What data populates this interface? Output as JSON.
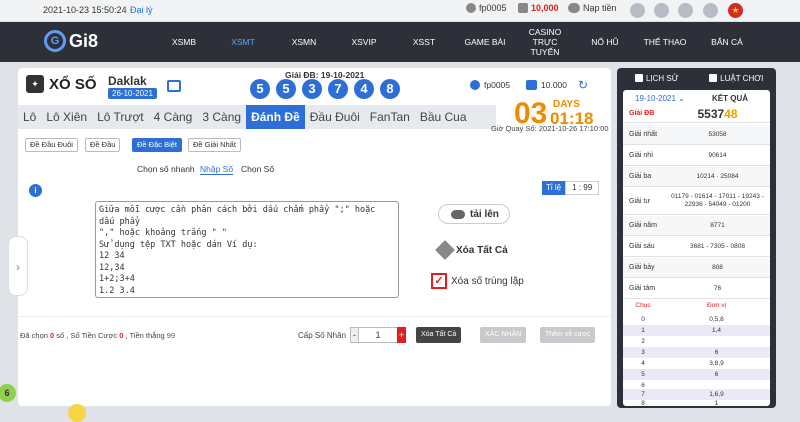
{
  "topbar": {
    "datetime": "2021-10-23 15:50:24",
    "agent": "Đại lý",
    "username": "fp0005",
    "balance": "10,000",
    "deposit": "Nạp tiền",
    "flag": "★"
  },
  "nav": {
    "logo": "Gi8",
    "items": [
      {
        "label": "XSMB"
      },
      {
        "label": "XSMT"
      },
      {
        "label": "XSMN"
      },
      {
        "label": "XSVIP"
      },
      {
        "label": "XSST"
      },
      {
        "label": "GAME BÀI"
      },
      {
        "label": "CASINO TRỰC TUYẾN"
      },
      {
        "label": "NỔ HŨ"
      },
      {
        "label": "THỂ THAO"
      },
      {
        "label": "BẮN CÁ"
      }
    ]
  },
  "game": {
    "title": "XỔ SỐ",
    "province": "Daklak",
    "province_date": "26-10-2021",
    "gdb_label": "Giải ĐB: 19-10-2021",
    "balls": [
      "5",
      "5",
      "3",
      "7",
      "4",
      "8"
    ],
    "account": "fp0005",
    "account_balance": "10.000",
    "tabs": [
      {
        "label": "Lô"
      },
      {
        "label": "Lô Xiên"
      },
      {
        "label": "Lô Trượt"
      },
      {
        "label": "4 Càng"
      },
      {
        "label": "3 Càng"
      },
      {
        "label": "Đánh Đề"
      },
      {
        "label": "Đầu Đuôi"
      },
      {
        "label": "FanTan"
      },
      {
        "label": "Bầu Cua"
      }
    ],
    "countdown": {
      "days_num": "03",
      "days_label": "DAYS",
      "time": "01:18",
      "next_draw": "Giờ Quay Số: 2021-10-26 17:10:00"
    },
    "subtabs": [
      "Đề Đầu Đuôi",
      "Đề Đầu",
      "Đề Đặc Biệt",
      "Đề Giải Nhất"
    ],
    "modes": [
      "Chọn số nhanh",
      "Nhập Số",
      "Chọn Số"
    ],
    "ratio_label": "Tỉ lệ",
    "ratio_value": "1 : 99",
    "textarea": "Giữa mỗi cược cần phân cách bởi dấu chấm phẩy \";\" hoặc dấu phẩy\n\",\" hoặc khoảng trắng \" \"\nSử dụng tệp TXT hoặc dán Ví dụ:\n12 34\n12,34\n1+2;3+4\n1.2 3.4",
    "upload_label": "tải lên",
    "clear_all_label": "Xóa Tất Cả",
    "dedupe_label": "Xóa số trùng lặp",
    "bottom": {
      "chosen_prefix": "Đã chọn",
      "chosen_count": "0",
      "chosen_suffix": "số ,",
      "bet_prefix": "Số Tiền Cược",
      "bet_amount": "0",
      "win_prefix": ", Tiền thắng",
      "win_amount": "99",
      "multiplier_label": "Cấp Số Nhân",
      "multiplier_value": "1",
      "clear_btn": "Xóa Tất Cả",
      "confirm_btn": "XÁC NHẬN",
      "add_btn": "Thêm về cược"
    },
    "left_ball": "6"
  },
  "results": {
    "history_label": "LỊCH SỬ",
    "rules_label": "LUẬT CHƠI",
    "date": "19-10-2021",
    "result_label": "KẾT QUẢ",
    "rows": [
      {
        "label": "Giải ĐB",
        "main": "5537",
        "highlight": "48"
      },
      {
        "label": "Giải nhất",
        "value": "53058"
      },
      {
        "label": "Giải nhì",
        "value": "90614"
      },
      {
        "label": "Giải ba",
        "value": "10214 · 25084"
      },
      {
        "label": "Giải tư",
        "value": "01179 - 01614 - 17011 - 19243 - 22936 - 54049 - 01200"
      },
      {
        "label": "Giải năm",
        "value": "8771"
      },
      {
        "label": "Giải sáu",
        "value": "3681 - 7305 - 0808"
      },
      {
        "label": "Giải bảy",
        "value": "808"
      },
      {
        "label": "Giải tám",
        "value": "76"
      }
    ],
    "lotto_headers": [
      "Chục",
      "Đơn vị"
    ],
    "lotto": [
      {
        "h": "0",
        "t": "0,5,8"
      },
      {
        "h": "1",
        "t": "1,4"
      },
      {
        "h": "2",
        "t": ""
      },
      {
        "h": "3",
        "t": "6"
      },
      {
        "h": "4",
        "t": "3,8,9"
      },
      {
        "h": "5",
        "t": "6"
      },
      {
        "h": "6",
        "t": ""
      },
      {
        "h": "7",
        "t": "1,6,9"
      },
      {
        "h": "8",
        "t": "1"
      }
    ]
  },
  "colors": {
    "accent": "#2d6fd6",
    "countdown": "#f08a00",
    "danger": "#e02020",
    "nav_bg": "#2d3038"
  }
}
